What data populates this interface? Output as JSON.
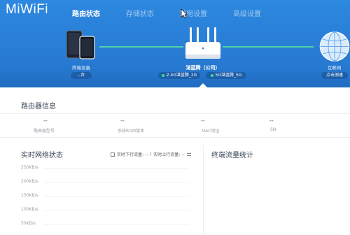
{
  "app": {
    "logo": "MiWiFi"
  },
  "nav": {
    "tabs": [
      {
        "label": "路由状态",
        "active": true
      },
      {
        "label": "存储状态",
        "active": false
      },
      {
        "label": "常用设置",
        "active": false
      },
      {
        "label": "高级设置",
        "active": false
      }
    ]
  },
  "topology": {
    "devices": {
      "label": "终端设备",
      "count_button": "--台",
      "icon": "tablet-phone-icon"
    },
    "router": {
      "name": "湛蓝腾（公司）",
      "icon": "router-icon",
      "wifi": [
        {
          "label": "2.4G湛蓝腾_2G"
        },
        {
          "label": "5G湛蓝腾_5G"
        }
      ]
    },
    "internet": {
      "label": "互联网",
      "button": "点击测速",
      "icon": "globe-icon"
    }
  },
  "router_info": {
    "title": "路由器信息",
    "fields": [
      {
        "value": "--",
        "label": "路由器型号"
      },
      {
        "value": "--",
        "label": "系统ROM版本"
      },
      {
        "value": "--",
        "label": "MAC地址"
      },
      {
        "value": "--",
        "label": "SN"
      }
    ]
  },
  "realtime": {
    "title": "实时网络状态",
    "download": "实时下行流量: --",
    "separator": "/",
    "upload": "实时上行流量: --",
    "y_axis_ticks": [
      "250KB/s",
      "200KB/s",
      "150KB/s",
      "100KB/s",
      "50KB/s"
    ]
  },
  "terminal_stats": {
    "title": "终端流量统计"
  },
  "colors": {
    "header_bg": "#2a80da",
    "connection_line": "#4fd3a9",
    "status_dot": "#3ee07f",
    "pill_bg": "#1d5ea8",
    "text_dark": "#3a4756",
    "text_muted": "#9aa0a6"
  },
  "cursor": {
    "icon": "mouse-pointer-icon"
  }
}
